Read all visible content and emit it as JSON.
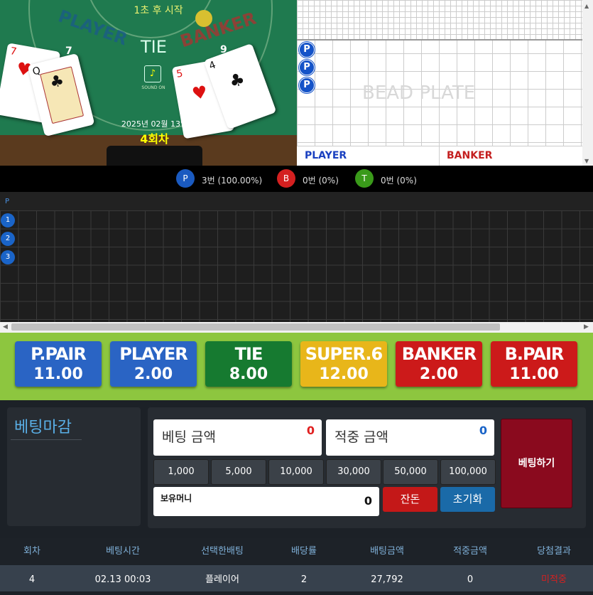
{
  "table": {
    "countdown": "1초 후 시작",
    "player_label": "PLAYER",
    "banker_label": "BANKER",
    "tie_label": "TIE",
    "player_score": "7",
    "banker_score": "9",
    "date": "2025년 02월 13일",
    "round": "4회차",
    "sound_label": "SOUND ON",
    "player_cards": [
      {
        "rank": "7",
        "suit": "♥"
      },
      {
        "rank": "Q",
        "suit": "♣"
      }
    ],
    "banker_cards": [
      {
        "rank": "5",
        "suit": "♥"
      },
      {
        "rank": "4",
        "suit": "♣"
      }
    ]
  },
  "bead_plate": {
    "title": "BEAD PLATE",
    "results": [
      "P",
      "P",
      "P"
    ],
    "player_label": "PLAYER",
    "banker_label": "BANKER"
  },
  "stats": {
    "player": {
      "icon": "P",
      "text": "3번 (100.00%)"
    },
    "banker": {
      "icon": "B",
      "text": "0번 (0%)"
    },
    "tie": {
      "icon": "T",
      "text": "0번 (0%)"
    }
  },
  "big_road": {
    "header": "P",
    "results": [
      "1",
      "2",
      "3"
    ]
  },
  "bets": [
    {
      "name": "P.PAIR",
      "odds": "11.00",
      "color": "#2a64c4"
    },
    {
      "name": "PLAYER",
      "odds": "2.00",
      "color": "#2a64c4"
    },
    {
      "name": "TIE",
      "odds": "8.00",
      "color": "#167a30"
    },
    {
      "name": "SUPER.6",
      "odds": "12.00",
      "color": "#e8b61a"
    },
    {
      "name": "BANKER",
      "odds": "2.00",
      "color": "#cc1a1a"
    },
    {
      "name": "B.PAIR",
      "odds": "11.00",
      "color": "#cc1a1a"
    }
  ],
  "panel": {
    "status": "베팅마감",
    "bet_amount_label": "베팅 금액",
    "bet_amount": "0",
    "win_amount_label": "적중 금액",
    "win_amount": "0",
    "chips": [
      "1,000",
      "5,000",
      "10,000",
      "30,000",
      "50,000",
      "100,000"
    ],
    "balance_label": "보유머니",
    "balance": "0",
    "change_button": "잔돈",
    "reset_button": "초기화",
    "bet_button": "베팅하기"
  },
  "history": {
    "headers": [
      "회차",
      "베팅시간",
      "선택한배팅",
      "배당률",
      "배팅금액",
      "적중금액",
      "당첨결과"
    ],
    "rows": [
      [
        "4",
        "02.13 00:03",
        "플레이어",
        "2",
        "27,792",
        "0",
        "미적중"
      ]
    ]
  },
  "colors": {
    "felt": "#1f7a4f",
    "player_blue": "#1453c8",
    "banker_red": "#cc1a1a",
    "tie_green": "#167a30",
    "bet_bar": "#8dc63f"
  }
}
